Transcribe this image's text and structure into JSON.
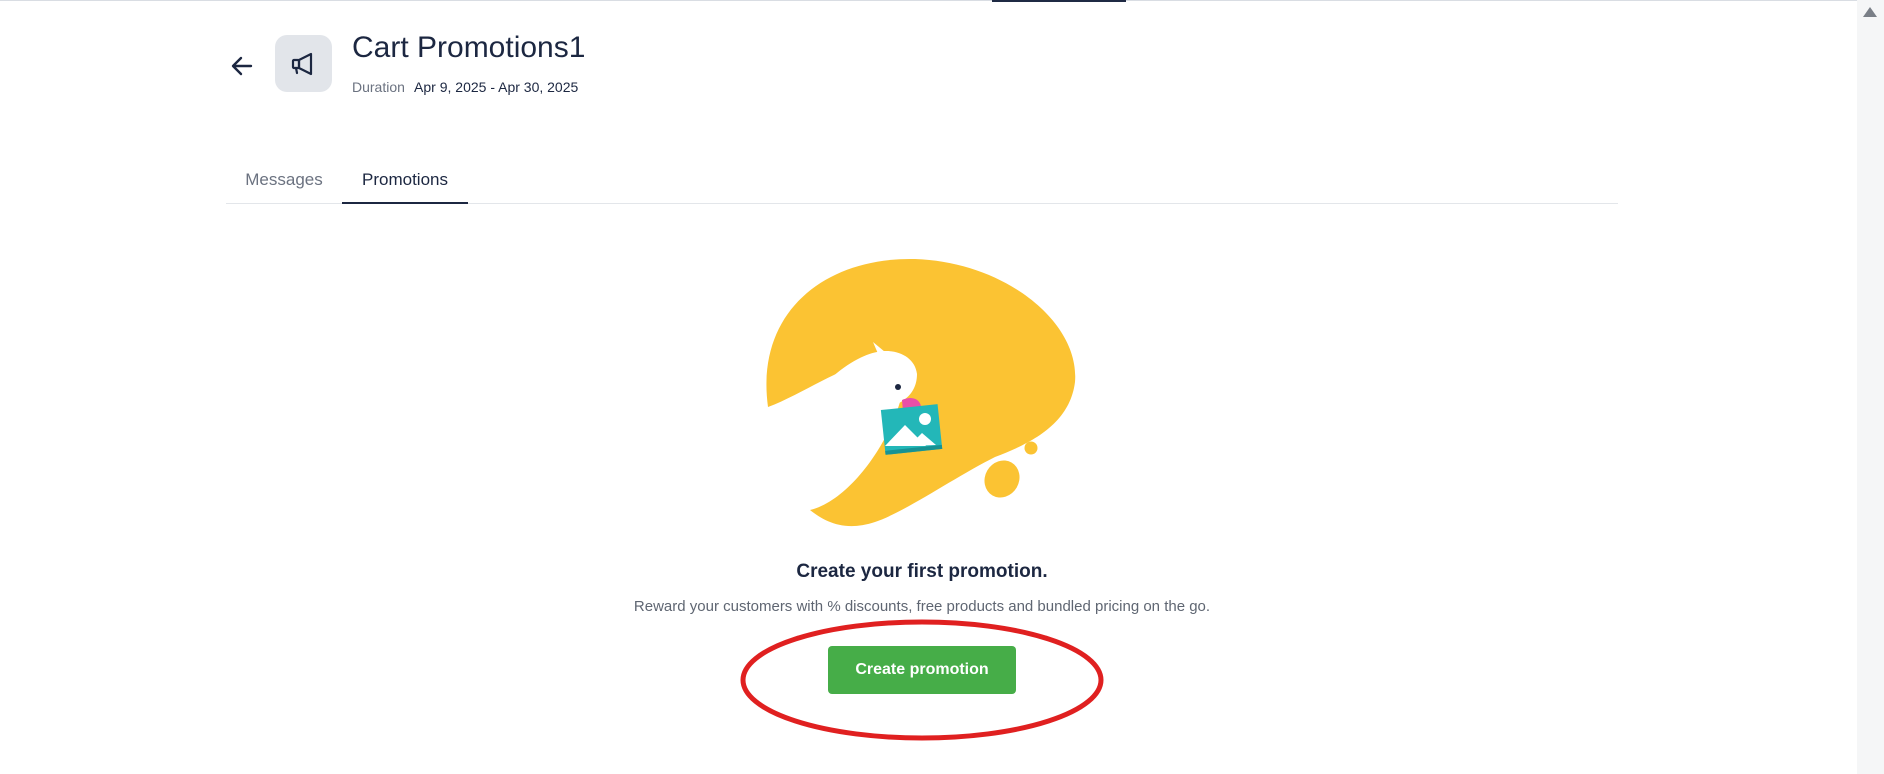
{
  "header": {
    "title": "Cart Promotions1",
    "duration_label": "Duration",
    "duration_value": "Apr 9, 2025 - Apr 30, 2025"
  },
  "tabs": [
    {
      "label": "Messages",
      "active": false
    },
    {
      "label": "Promotions",
      "active": true
    }
  ],
  "empty_state": {
    "title": "Create your first promotion.",
    "description": "Reward your customers with % discounts, free products and bundled pricing on the go.",
    "button_label": "Create promotion"
  },
  "icons": {
    "back": "arrow-left-icon",
    "campaign": "megaphone-icon",
    "illustration": "bird-holding-image-illustration",
    "scroll": "scroll-up-arrow-icon"
  },
  "colors": {
    "primary_button": "#46ad48",
    "text_dark": "#1c2741",
    "illustration_yellow": "#fbc333",
    "annotation_red": "#e02020"
  }
}
